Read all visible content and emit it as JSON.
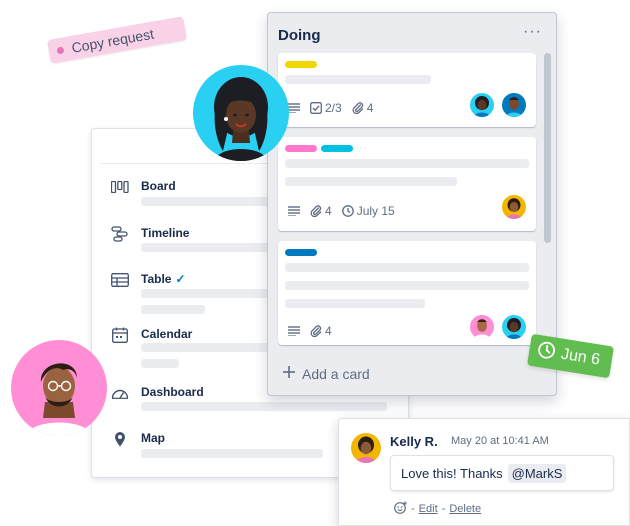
{
  "copy_request": {
    "label": "Copy request"
  },
  "views": {
    "items": [
      {
        "label": "Board",
        "icon": "board-icon"
      },
      {
        "label": "Timeline",
        "icon": "timeline-icon"
      },
      {
        "label": "Table",
        "icon": "table-icon",
        "checked": true
      },
      {
        "label": "Calendar",
        "icon": "calendar-icon"
      },
      {
        "label": "Dashboard",
        "icon": "dashboard-icon"
      },
      {
        "label": "Map",
        "icon": "map-pin-icon"
      }
    ]
  },
  "list": {
    "title": "Doing",
    "menu": "···",
    "add_card": "Add a card",
    "cards": [
      {
        "labels": [
          "#f2d600"
        ],
        "badges": {
          "checklist": "2/3",
          "attachments": "4"
        }
      },
      {
        "labels": [
          "#ff78cb",
          "#00c2e0"
        ],
        "badges": {
          "attachments": "4",
          "due": "July 15"
        }
      },
      {
        "labels": [
          "#0079bf"
        ],
        "badges": {
          "attachments": "4"
        }
      }
    ]
  },
  "sticker": {
    "date": "Jun 6",
    "color": "#61bd4f"
  },
  "comment": {
    "author": "Kelly R.",
    "time": "May 20 at 10:41 AM",
    "text": "Love this! Thanks",
    "mention": "@MarkS",
    "actions": {
      "sep": "-",
      "edit": "Edit",
      "delete": "Delete"
    }
  },
  "colors": {
    "accent": "#0079bf",
    "pink": "#ff8ed4",
    "cyan": "#2ad0f2"
  }
}
